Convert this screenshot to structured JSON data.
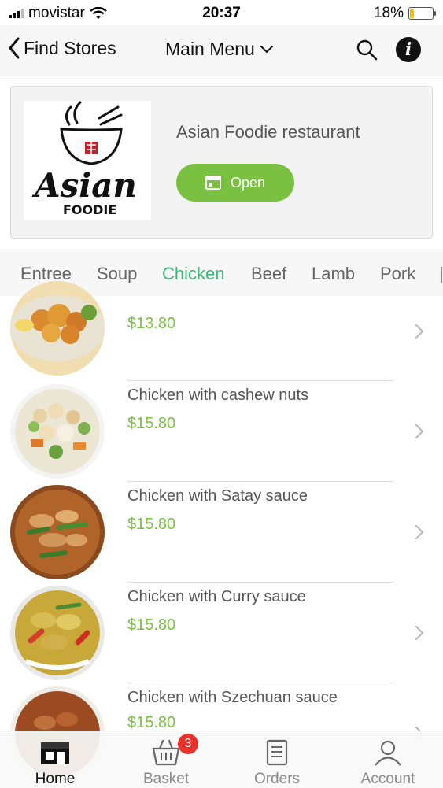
{
  "status_bar": {
    "carrier": "movistar",
    "time": "20:37",
    "battery": "18%",
    "battery_level": 0.18
  },
  "nav": {
    "back_label": "Find Stores",
    "title": "Main Menu"
  },
  "store": {
    "name": "Asian Foodie restaurant",
    "open_label": "Open",
    "logo_text_main": "Asian",
    "logo_text_sub": "FOODIE"
  },
  "categories": [
    "Entree",
    "Soup",
    "Chicken",
    "Beef",
    "Lamb",
    "Pork"
  ],
  "active_category": "Chicken",
  "menu_items": [
    {
      "name": "",
      "price": "$13.80"
    },
    {
      "name": "Chicken with cashew nuts",
      "price": "$15.80"
    },
    {
      "name": "Chicken with Satay sauce",
      "price": "$15.80"
    },
    {
      "name": "Chicken with Curry sauce",
      "price": "$15.80"
    },
    {
      "name": "Chicken with Szechuan sauce",
      "price": "$15.80"
    }
  ],
  "tab_bar": {
    "home": "Home",
    "basket": "Basket",
    "orders": "Orders",
    "account": "Account",
    "basket_count": "3"
  },
  "colors": {
    "accent_green": "#7ac142",
    "active_tab_green": "#3bb873",
    "badge_red": "#e8322b"
  }
}
